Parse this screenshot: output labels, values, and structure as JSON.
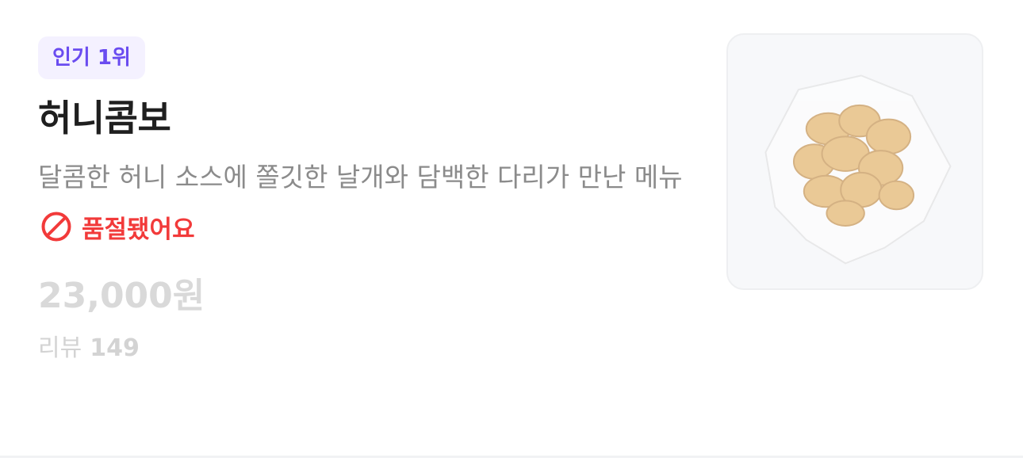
{
  "menu_item": {
    "badge": "인기 1위",
    "name": "허니콤보",
    "description": "달콤한 허니 소스에 쫄깃한 날개와 담백한 다리가 만난 메뉴",
    "status": "품절됐어요",
    "status_icon": "prohibited-icon",
    "price": "23,000원",
    "reviews_label": "리뷰",
    "reviews_count": "149",
    "image_icon": "fried-chicken-basket-icon"
  },
  "colors": {
    "badge_text": "#6a4cf0",
    "badge_bg": "#f4f1ff",
    "soldout": "#f23a3a",
    "title": "#1f1f1f",
    "description": "#8b8b8b",
    "muted": "#d9d9d9"
  }
}
